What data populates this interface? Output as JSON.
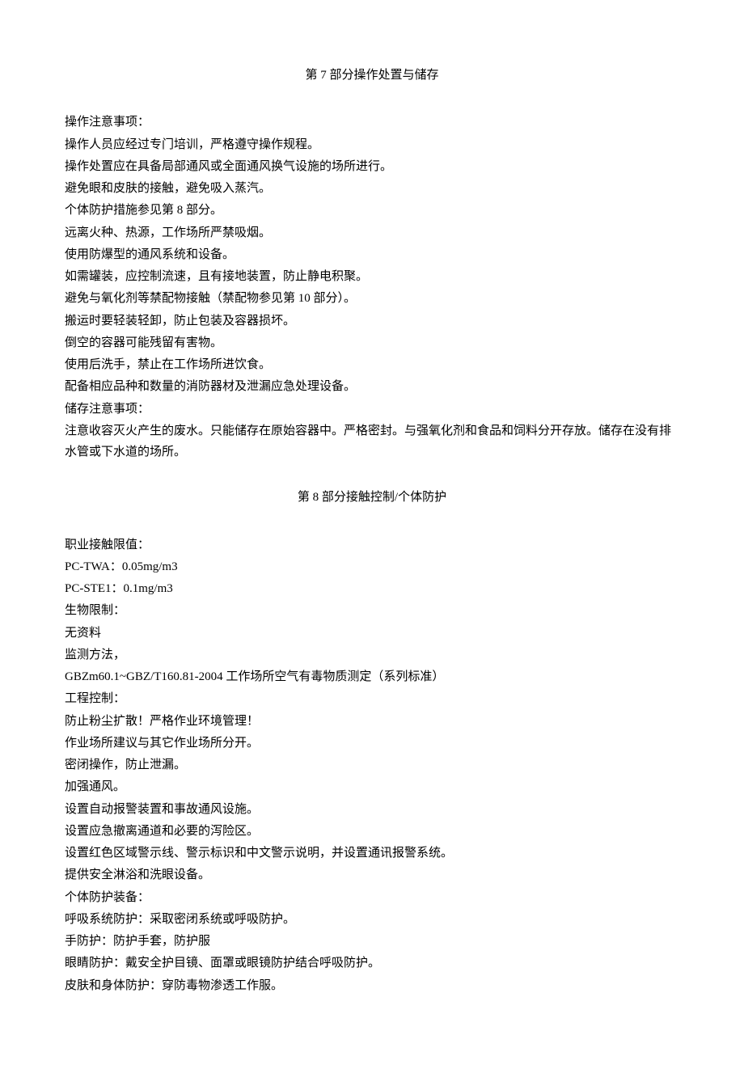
{
  "section7": {
    "title": "第 7 部分操作处置与储存",
    "lines": [
      "操作注意事项：",
      "操作人员应经过专门培训，严格遵守操作规程。",
      "操作处置应在具备局部通风或全面通风换气设施的场所进行。",
      "避免眼和皮肤的接触，避免吸入蒸汽。",
      "个体防护措施参见第 8 部分。",
      "远离火种、热源，工作场所严禁吸烟。",
      "使用防爆型的通风系统和设备。",
      "如需罐装，应控制流速，且有接地装置，防止静电积聚。",
      "避免与氧化剂等禁配物接触（禁配物参见第 10 部分）。",
      "搬运时要轻装轻卸，防止包装及容器损坏。",
      "倒空的容器可能残留有害物。",
      "使用后洗手，禁止在工作场所进饮食。",
      "配备相应品种和数量的消防器材及泄漏应急处理设备。",
      "储存注意事项：",
      "注意收容灭火产生的废水。只能储存在原始容器中。严格密封。与强氧化剂和食品和饲料分开存放。储存在没有排水管或下水道的场所。"
    ]
  },
  "section8": {
    "title": "第 8 部分接触控制/个体防护",
    "lines": [
      "职业接触限值：",
      "PC-TWA：0.05mg/m3",
      "PC-STE1：0.1mg/m3",
      "生物限制：",
      "无资料",
      "监测方法，",
      "GBZm60.1~GBZ/T160.81-2004 工作场所空气有毒物质测定（系列标准）",
      "工程控制：",
      "防止粉尘扩散！严格作业环境管理！",
      "作业场所建议与其它作业场所分开。",
      "密闭操作，防止泄漏。",
      "加强通风。",
      "设置自动报警装置和事故通风设施。",
      "设置应急撤离通道和必要的泻险区。",
      "设置红色区域警示线、警示标识和中文警示说明，并设置通讯报警系统。",
      "提供安全淋浴和洗眼设备。",
      "个体防护装备：",
      "呼吸系统防护：采取密闭系统或呼吸防护。",
      "手防护：防护手套，防护服",
      "眼睛防护：戴安全护目镜、面罩或眼镜防护结合呼吸防护。",
      "皮肤和身体防护：穿防毒物渗透工作服。"
    ]
  }
}
